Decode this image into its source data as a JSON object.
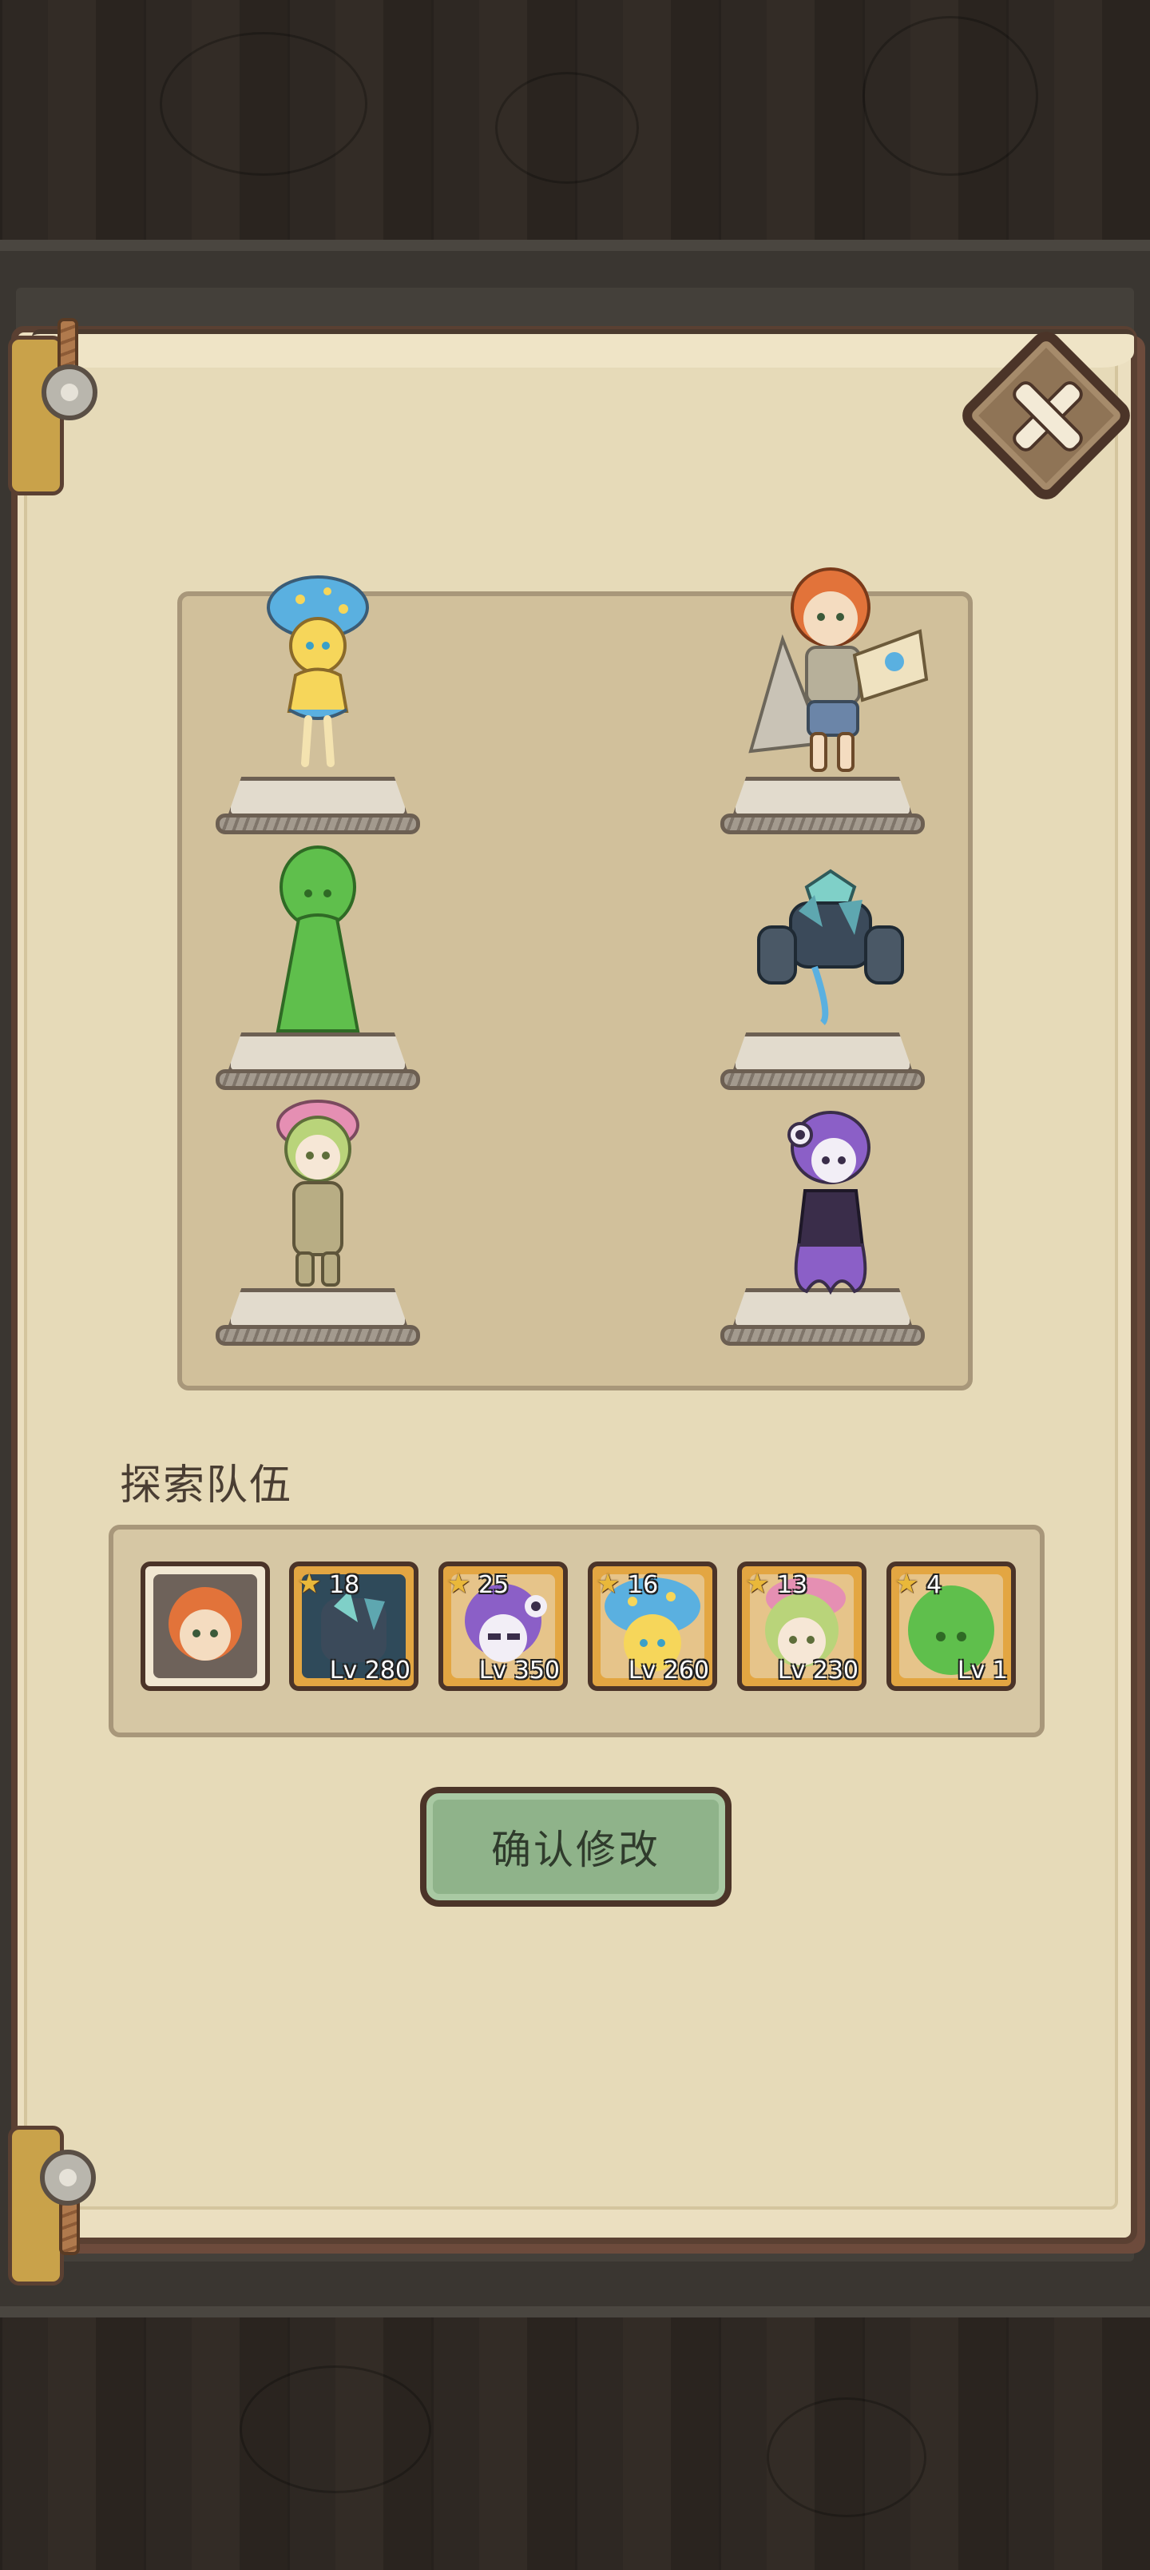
{
  "close_button": {
    "icon": "close-icon"
  },
  "stage": {
    "left_column": [
      {
        "name": "mushroom-girl",
        "hair": "#f6d65a",
        "accent": "#5ab0e0"
      },
      {
        "name": "green-slime-girl",
        "hair": "#5fbf4c",
        "accent": "#3f9a34"
      },
      {
        "name": "flower-girl",
        "hair": "#b9d47a",
        "accent": "#e58fb3"
      }
    ],
    "right_column": [
      {
        "name": "explorer-boy",
        "hair": "#e2733a",
        "accent": "#8a7a64"
      },
      {
        "name": "crystal-golem",
        "hair": "#5ea7b0",
        "accent": "#3b4a5a"
      },
      {
        "name": "octopus-girl",
        "hair": "#8b5fc7",
        "accent": "#3a2d4a"
      }
    ]
  },
  "team": {
    "title": "探索队伍",
    "members": [
      {
        "name": "leader-portrait",
        "leader": true,
        "color": "#e2733a"
      },
      {
        "name": "crystal-golem",
        "count": "18",
        "level": "Lv 280",
        "color": "#5ea7b0"
      },
      {
        "name": "octopus-girl",
        "count": "25",
        "level": "Lv 350",
        "color": "#8b5fc7"
      },
      {
        "name": "mushroom-girl",
        "count": "16",
        "level": "Lv 260",
        "color": "#f6d65a"
      },
      {
        "name": "flower-girl",
        "count": "13",
        "level": "Lv 230",
        "color": "#b9d47a"
      },
      {
        "name": "green-slime-girl",
        "count": "4",
        "level": "Lv 1",
        "color": "#5fbf4c"
      }
    ]
  },
  "confirm_button": {
    "label": "确认修改"
  },
  "colors": {
    "paper": "#ebdfc0",
    "stage": "#d1c09b",
    "button_green": "#8fb38a",
    "slot_gold": "#e3a642",
    "frame_brown": "#4b3428"
  }
}
